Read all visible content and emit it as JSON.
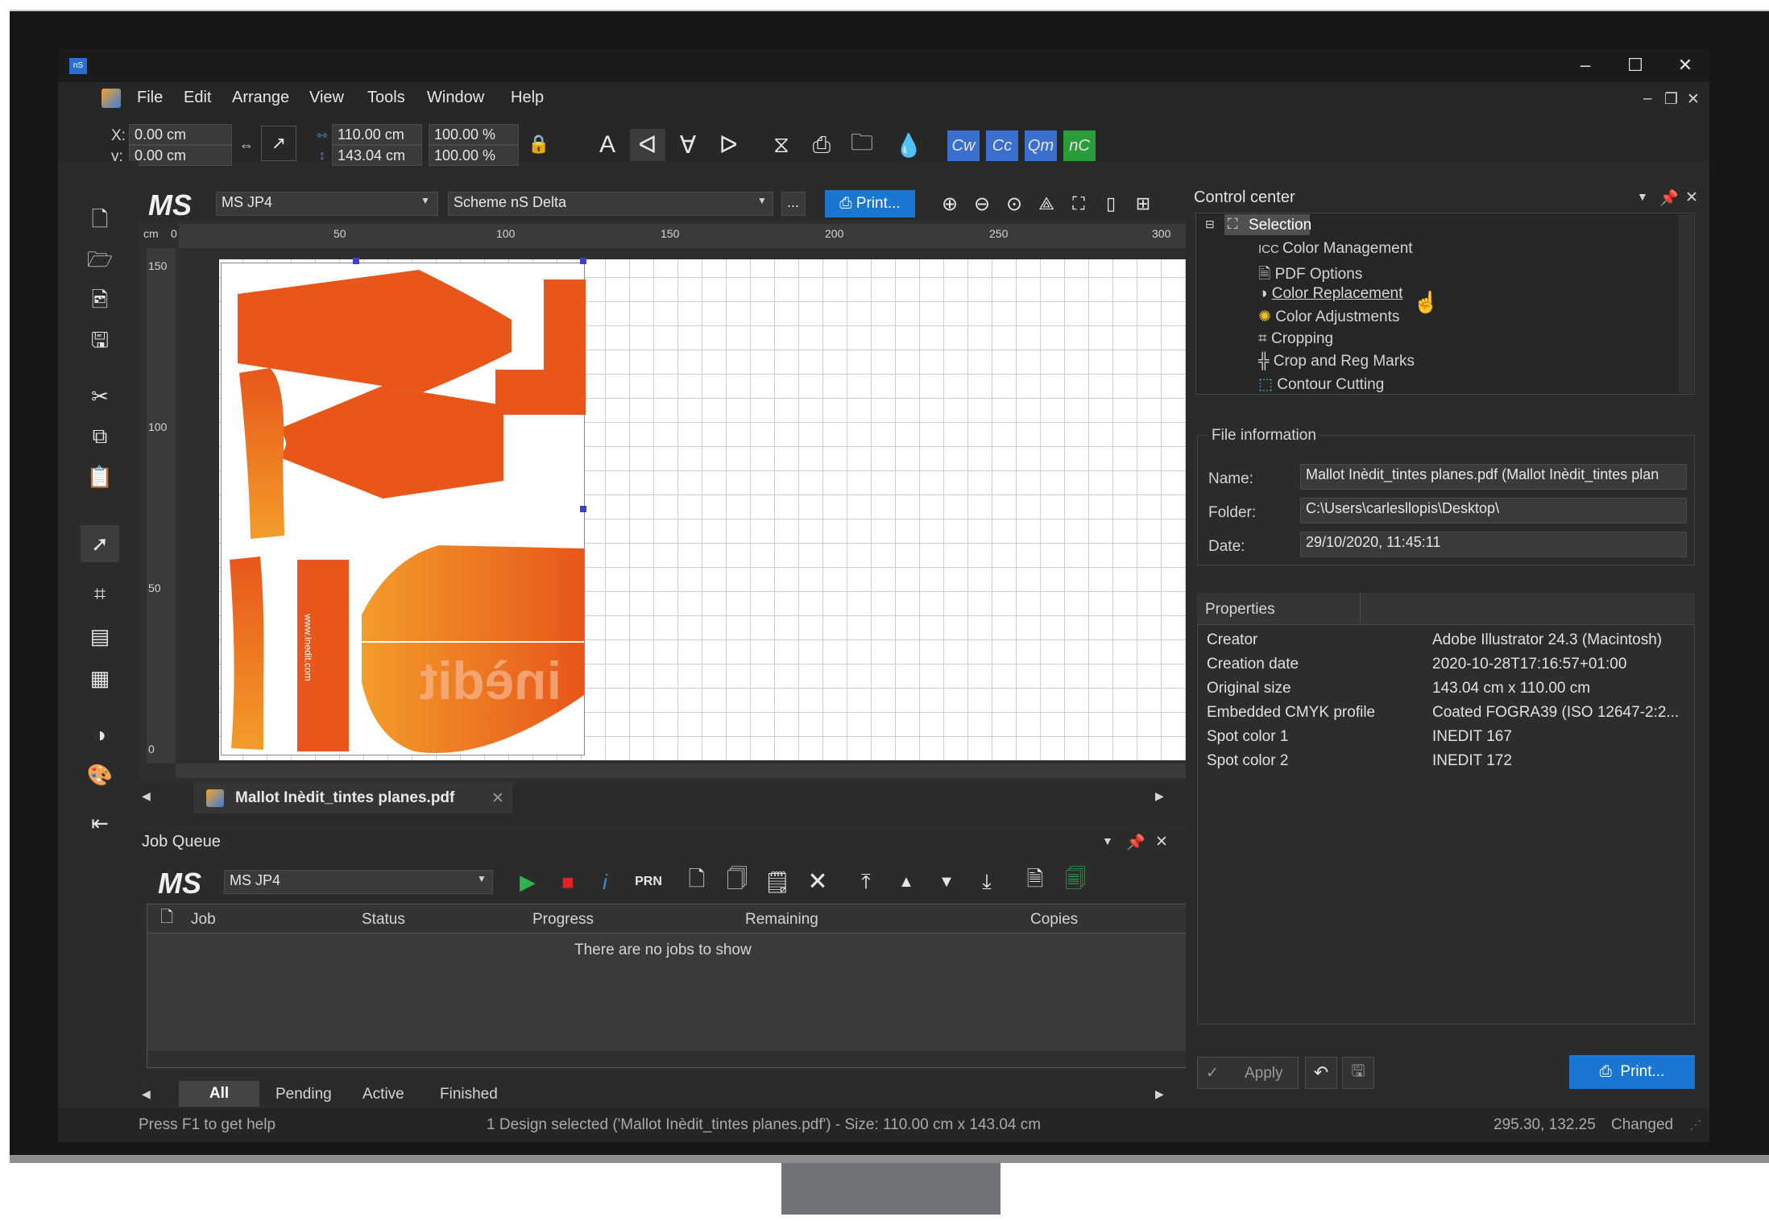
{
  "window": {
    "app_badge": "nS",
    "minimize": "–",
    "maximize": "☐",
    "close": "✕"
  },
  "menu": [
    "File",
    "Edit",
    "Arrange",
    "View",
    "Tools",
    "Window",
    "Help"
  ],
  "toolbar": {
    "x_label": "X:",
    "x_value": "0.00 cm",
    "y_label": "y:",
    "y_value": "0.00 cm",
    "width_value": "110.00 cm",
    "height_value": "143.04 cm",
    "width_pct": "100.00 %",
    "height_pct": "100.00 %",
    "cw": "Cw",
    "cc": "Cc",
    "qm": "Qm",
    "nc": "nC"
  },
  "doc": {
    "logo": "MS",
    "printer": "MS JP4",
    "scheme": "Scheme nS Delta",
    "more": "...",
    "print_button": "Print...",
    "ruler_unit": "cm",
    "ruler_h": [
      "0",
      "50",
      "100",
      "150",
      "200",
      "250",
      "300"
    ],
    "ruler_v": [
      "150",
      "100",
      "50",
      "0"
    ],
    "tab_name": "Mallot Inèdit_tintes planes.pdf",
    "tab_close": "✕"
  },
  "artwork": {
    "brand_text": "inèdit",
    "vertical_text": "www.inedit.com",
    "accent_color": "#e8561a",
    "gradient_start": "#f39c2a"
  },
  "job_queue": {
    "title": "Job Queue",
    "logo": "MS",
    "printer": "MS JP4",
    "prn": "PRN",
    "columns": [
      "Job",
      "Status",
      "Progress",
      "Remaining",
      "Copies"
    ],
    "empty": "There are no jobs to show",
    "tabs": [
      "All",
      "Pending",
      "Active",
      "Finished"
    ]
  },
  "control_center": {
    "title": "Control center",
    "tree": [
      "Selection",
      "Color Management",
      "PDF Options",
      "Color Replacement",
      "Color Adjustments",
      "Cropping",
      "Crop and Reg Marks",
      "Contour Cutting"
    ],
    "file_info_title": "File information",
    "name_label": "Name:",
    "name_value": "Mallot Inèdit_tintes planes.pdf (Mallot Inèdit_tintes plan",
    "folder_label": "Folder:",
    "folder_value": "C:\\Users\\carlesllopis\\Desktop\\",
    "date_label": "Date:",
    "date_value": "29/10/2020, 11:45:11",
    "properties_title": "Properties",
    "properties": [
      {
        "k": "Creator",
        "v": "Adobe Illustrator 24.3 (Macintosh)"
      },
      {
        "k": "Creation date",
        "v": "2020-10-28T17:16:57+01:00"
      },
      {
        "k": "Original size",
        "v": "143.04 cm x 110.00 cm"
      },
      {
        "k": "Embedded CMYK profile",
        "v": "Coated FOGRA39 (ISO 12647-2:2..."
      },
      {
        "k": "Spot color 1",
        "v": "INEDIT 167"
      },
      {
        "k": "Spot color 2",
        "v": "INEDIT 172"
      }
    ],
    "apply": "Apply",
    "print": "Print..."
  },
  "status": {
    "help": "Press F1 to get help",
    "selection": "1 Design selected ('Mallot Inèdit_tintes planes.pdf') - Size: 110.00 cm x 143.04 cm",
    "coords": "295.30, 132.25",
    "changed": "Changed"
  }
}
